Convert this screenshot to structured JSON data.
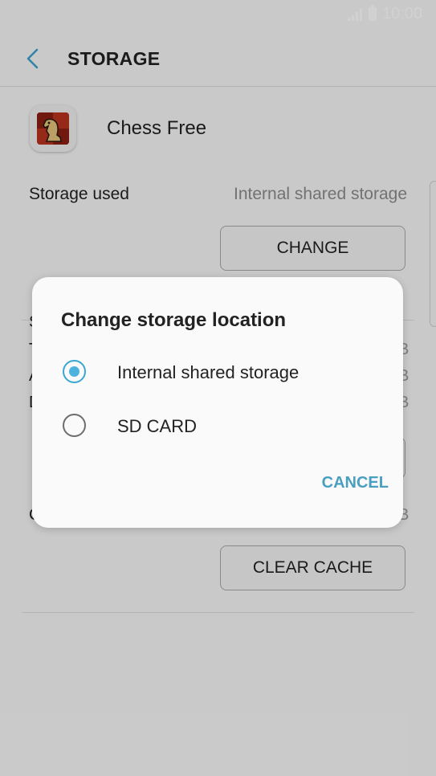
{
  "status_bar": {
    "time": "10:00",
    "icons": [
      "signal-icon",
      "battery-icon"
    ]
  },
  "header": {
    "title": "STORAGE",
    "back_icon": "chevron-left-icon"
  },
  "app": {
    "name": "Chess Free",
    "icon": "chess-knight-icon"
  },
  "storage": {
    "used_label": "Storage used",
    "used_value": "Internal shared storage",
    "change_label": "CHANGE"
  },
  "background_rows": [
    {
      "left": "S",
      "right": ""
    },
    {
      "left": "T",
      "right": "B"
    },
    {
      "left": "A",
      "right": "B"
    },
    {
      "left": "D",
      "right": "B"
    }
  ],
  "cache": {
    "left": "C",
    "right": "B",
    "clear_label": "CLEAR CACHE"
  },
  "dialog": {
    "title": "Change storage location",
    "options": [
      {
        "label": "Internal shared storage",
        "selected": true
      },
      {
        "label": "SD CARD",
        "selected": false
      }
    ],
    "cancel_label": "CANCEL"
  },
  "colors": {
    "accent": "#4cb3de",
    "cancel": "#4a9fc0",
    "background": "#f6f6f6",
    "dialog": "#fafafa",
    "secondary_text": "#8c8c8c"
  }
}
